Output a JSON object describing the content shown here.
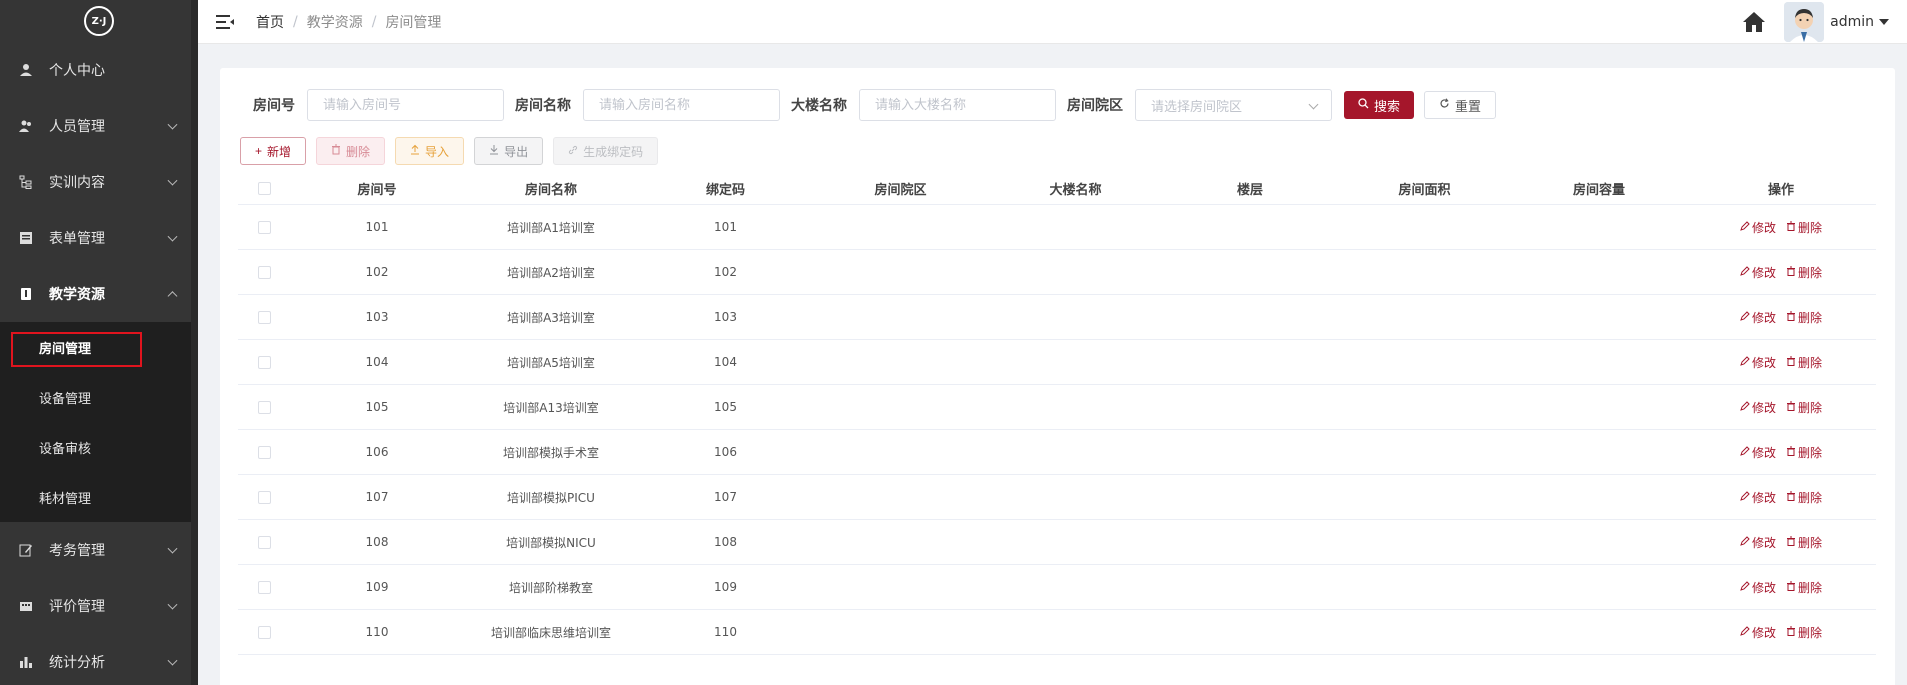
{
  "sidebar": {
    "logo_text": "Z·J",
    "items": [
      {
        "label": "个人中心",
        "icon": "user-icon",
        "has_children": false
      },
      {
        "label": "人员管理",
        "icon": "users-icon",
        "has_children": true
      },
      {
        "label": "实训内容",
        "icon": "tree-icon",
        "has_children": true
      },
      {
        "label": "表单管理",
        "icon": "form-icon",
        "has_children": true
      },
      {
        "label": "教学资源",
        "icon": "book-icon",
        "has_children": true,
        "expanded": true
      }
    ],
    "sub_items": [
      {
        "label": "房间管理",
        "active": true
      },
      {
        "label": "设备管理"
      },
      {
        "label": "设备审核"
      },
      {
        "label": "耗材管理"
      }
    ],
    "items_after": [
      {
        "label": "考务管理",
        "icon": "edit-icon"
      },
      {
        "label": "评价管理",
        "icon": "rating-icon"
      },
      {
        "label": "统计分析",
        "icon": "chart-icon"
      }
    ]
  },
  "header": {
    "breadcrumb": [
      "首页",
      "教学资源",
      "房间管理"
    ],
    "user": "admin"
  },
  "search": {
    "room_no_label": "房间号",
    "room_no_placeholder": "请输入房间号",
    "room_name_label": "房间名称",
    "room_name_placeholder": "请输入房间名称",
    "building_label": "大楼名称",
    "building_placeholder": "请输入大楼名称",
    "campus_label": "房间院区",
    "campus_placeholder": "请选择房间院区",
    "search_btn": "搜索",
    "reset_btn": "重置"
  },
  "toolbar": {
    "add": "新增",
    "delete": "删除",
    "import": "导入",
    "export": "导出",
    "gen_code": "生成绑定码"
  },
  "table": {
    "columns": [
      "房间号",
      "房间名称",
      "绑定码",
      "房间院区",
      "大楼名称",
      "楼层",
      "房间面积",
      "房间容量",
      "操作"
    ],
    "edit_label": "修改",
    "delete_label": "删除",
    "rows": [
      {
        "no": "101",
        "name": "培训部A1培训室",
        "code": "101"
      },
      {
        "no": "102",
        "name": "培训部A2培训室",
        "code": "102"
      },
      {
        "no": "103",
        "name": "培训部A3培训室",
        "code": "103"
      },
      {
        "no": "104",
        "name": "培训部A5培训室",
        "code": "104"
      },
      {
        "no": "105",
        "name": "培训部A13培训室",
        "code": "105"
      },
      {
        "no": "106",
        "name": "培训部模拟手术室",
        "code": "106"
      },
      {
        "no": "107",
        "name": "培训部模拟PICU",
        "code": "107"
      },
      {
        "no": "108",
        "name": "培训部模拟NICU",
        "code": "108"
      },
      {
        "no": "109",
        "name": "培训部阶梯教室",
        "code": "109"
      },
      {
        "no": "110",
        "name": "培训部临床思维培训室",
        "code": "110"
      }
    ]
  },
  "colors": {
    "accent": "#a5162b",
    "sidebar_bg": "#353535",
    "submenu_bg": "#1f1f1f",
    "highlight_box": "#e0141e"
  }
}
